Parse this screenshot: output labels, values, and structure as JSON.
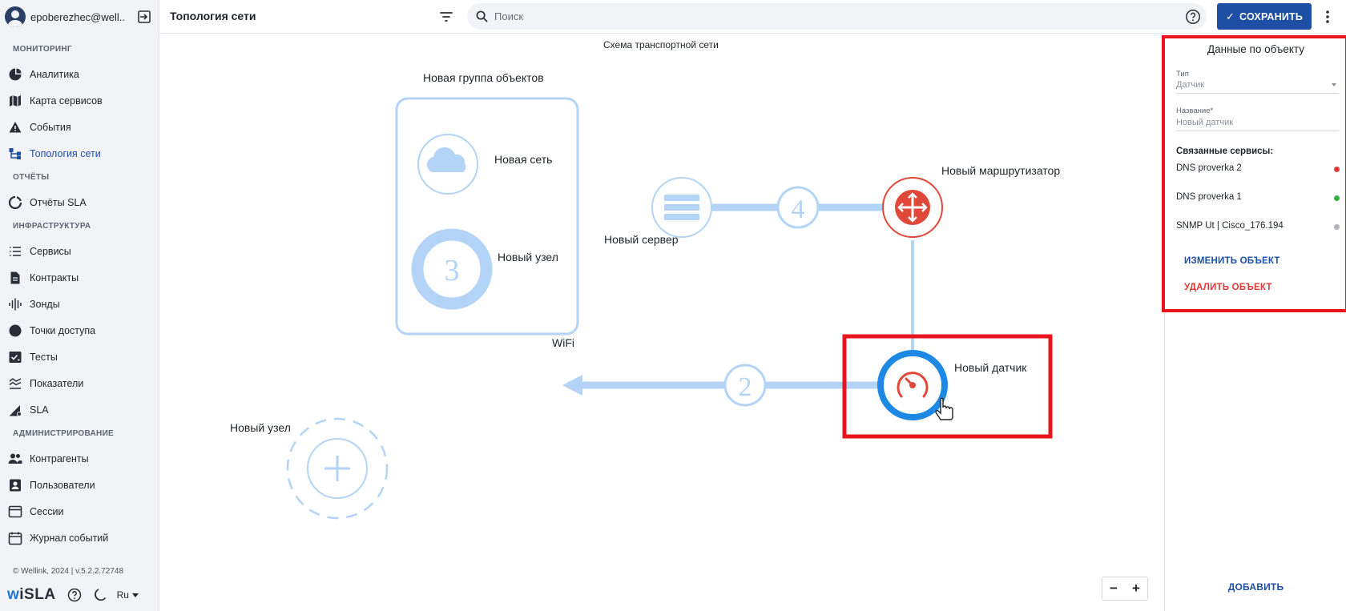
{
  "user": {
    "name": "epoberezhec@well..."
  },
  "nav": {
    "sections": [
      {
        "title": "МОНИТОРИНГ",
        "items": [
          {
            "label": "Аналитика",
            "icon": "pie-chart-icon"
          },
          {
            "label": "Карта сервисов",
            "icon": "map-icon"
          },
          {
            "label": "События",
            "icon": "warning-icon"
          },
          {
            "label": "Топология сети",
            "icon": "topology-icon",
            "active": true
          }
        ]
      },
      {
        "title": "ОТЧЁТЫ",
        "items": [
          {
            "label": "Отчёты SLA",
            "icon": "report-circle-icon"
          }
        ]
      },
      {
        "title": "ИНФРАСТРУКТУРА",
        "items": [
          {
            "label": "Сервисы",
            "icon": "list-icon"
          },
          {
            "label": "Контракты",
            "icon": "document-icon"
          },
          {
            "label": "Зонды",
            "icon": "probe-icon"
          },
          {
            "label": "Точки доступа",
            "icon": "dot-icon"
          },
          {
            "label": "Тесты",
            "icon": "test-icon"
          },
          {
            "label": "Показатели",
            "icon": "metrics-icon"
          },
          {
            "label": "SLA",
            "icon": "sla-icon"
          }
        ]
      },
      {
        "title": "АДМИНИСТРИРОВАНИЕ",
        "items": [
          {
            "label": "Контрагенты",
            "icon": "people-icon"
          },
          {
            "label": "Пользователи",
            "icon": "user-card-icon"
          },
          {
            "label": "Сессии",
            "icon": "window-icon"
          },
          {
            "label": "Журнал событий",
            "icon": "calendar-icon"
          }
        ]
      }
    ]
  },
  "footer": {
    "copyright": "© Wellink, 2024 | v.5.2.2.72748",
    "logo": "wiSLA",
    "language": "Ru"
  },
  "header": {
    "title": "Топология сети",
    "search_placeholder": "Поиск",
    "save_label": "СОХРАНИТЬ"
  },
  "canvas": {
    "schema_title": "Схема транспортной сети",
    "group_label": "Новая группа объектов",
    "network_label": "Новая сеть",
    "node_label": "Новый узел",
    "node_count": "3",
    "server_label": "Новый сервер",
    "router_label": "Новый маршрутизатор",
    "link_server_router_count": "4",
    "wifi_label": "WiFi",
    "link_wifi_count": "2",
    "sensor_label": "Новый датчик",
    "new_node_label": "Новый узел",
    "zoom_out": "−",
    "zoom_in": "+"
  },
  "panel": {
    "title": "Данные по объекту",
    "type_label": "Тип",
    "type_value": "Датчик",
    "name_label": "Название*",
    "name_placeholder": "Новый датчик",
    "linked_title": "Связанные сервисы:",
    "services": [
      {
        "name": "DNS proverka 2",
        "status_color": "#e53935"
      },
      {
        "name": "DNS proverka 1",
        "status_color": "#2fb344"
      },
      {
        "name": "SNMP Ut | Cisco_176.194",
        "status_color": "#b0b4ba"
      }
    ],
    "edit_label": "ИЗМЕНИТЬ ОБЪЕКТ",
    "delete_label": "УДАЛИТЬ ОБЪЕКТ",
    "add_label": "ДОБАВИТЬ"
  },
  "colors": {
    "accent": "#1e4fa5",
    "highlight_red": "#e8161c",
    "link_light": "#b3d3f7",
    "sensor_ring": "#1e88e5",
    "device_red": "#e0483a",
    "delete_red": "#e53935"
  }
}
